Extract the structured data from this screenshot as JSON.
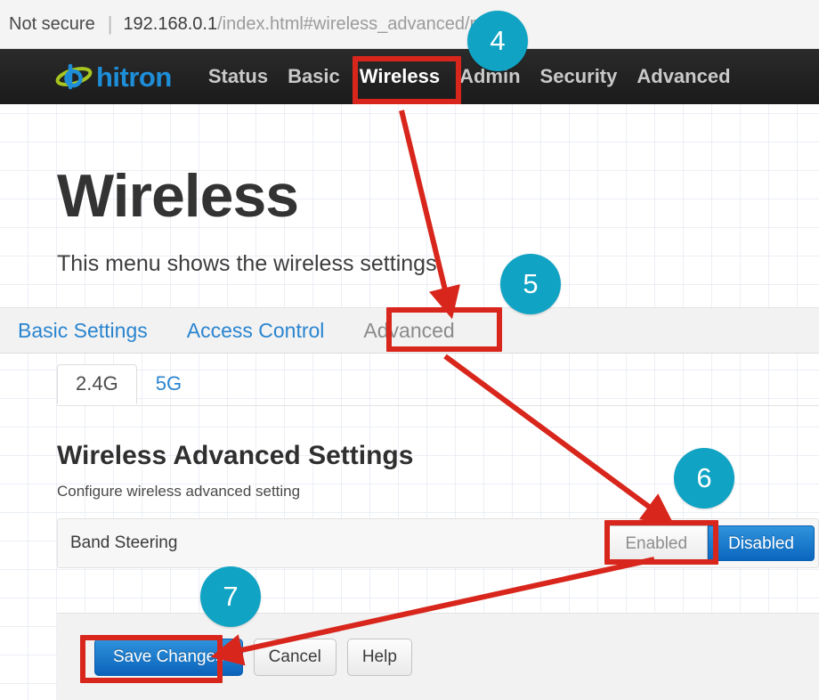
{
  "browser": {
    "security_label": "Not secure",
    "separator": "|",
    "url_host": "192.168.0.1",
    "url_path": "/index.html#wireless_advanced/m"
  },
  "navbar": {
    "logo_text": "hitron",
    "logo_icon": "hitron-swirl-icon",
    "items": [
      {
        "label": "Status",
        "active": false
      },
      {
        "label": "Basic",
        "active": false
      },
      {
        "label": "Wireless",
        "active": true
      },
      {
        "label": "Admin",
        "active": false
      },
      {
        "label": "Security",
        "active": false
      },
      {
        "label": "Advanced",
        "active": false
      }
    ]
  },
  "page": {
    "title": "Wireless",
    "subtitle": "This menu shows the wireless settings"
  },
  "section_tabs": [
    {
      "label": "Basic Settings",
      "active": false
    },
    {
      "label": "Access Control",
      "active": false
    },
    {
      "label": "Advanced",
      "active": true
    }
  ],
  "band_tabs": [
    {
      "label": "2.4G",
      "active": true
    },
    {
      "label": "5G",
      "active": false
    }
  ],
  "section": {
    "heading": "Wireless Advanced Settings",
    "description": "Configure wireless advanced setting"
  },
  "settings": {
    "band_steering": {
      "label": "Band Steering",
      "option_enabled": "Enabled",
      "option_disabled": "Disabled",
      "selected": "Disabled"
    }
  },
  "footer": {
    "save_label": "Save Changes",
    "cancel_label": "Cancel",
    "help_label": "Help"
  },
  "annotations": {
    "accent_color": "#10a3c4",
    "highlight_color": "#d8261c",
    "steps": [
      {
        "number": "4"
      },
      {
        "number": "5"
      },
      {
        "number": "6"
      },
      {
        "number": "7"
      }
    ]
  }
}
